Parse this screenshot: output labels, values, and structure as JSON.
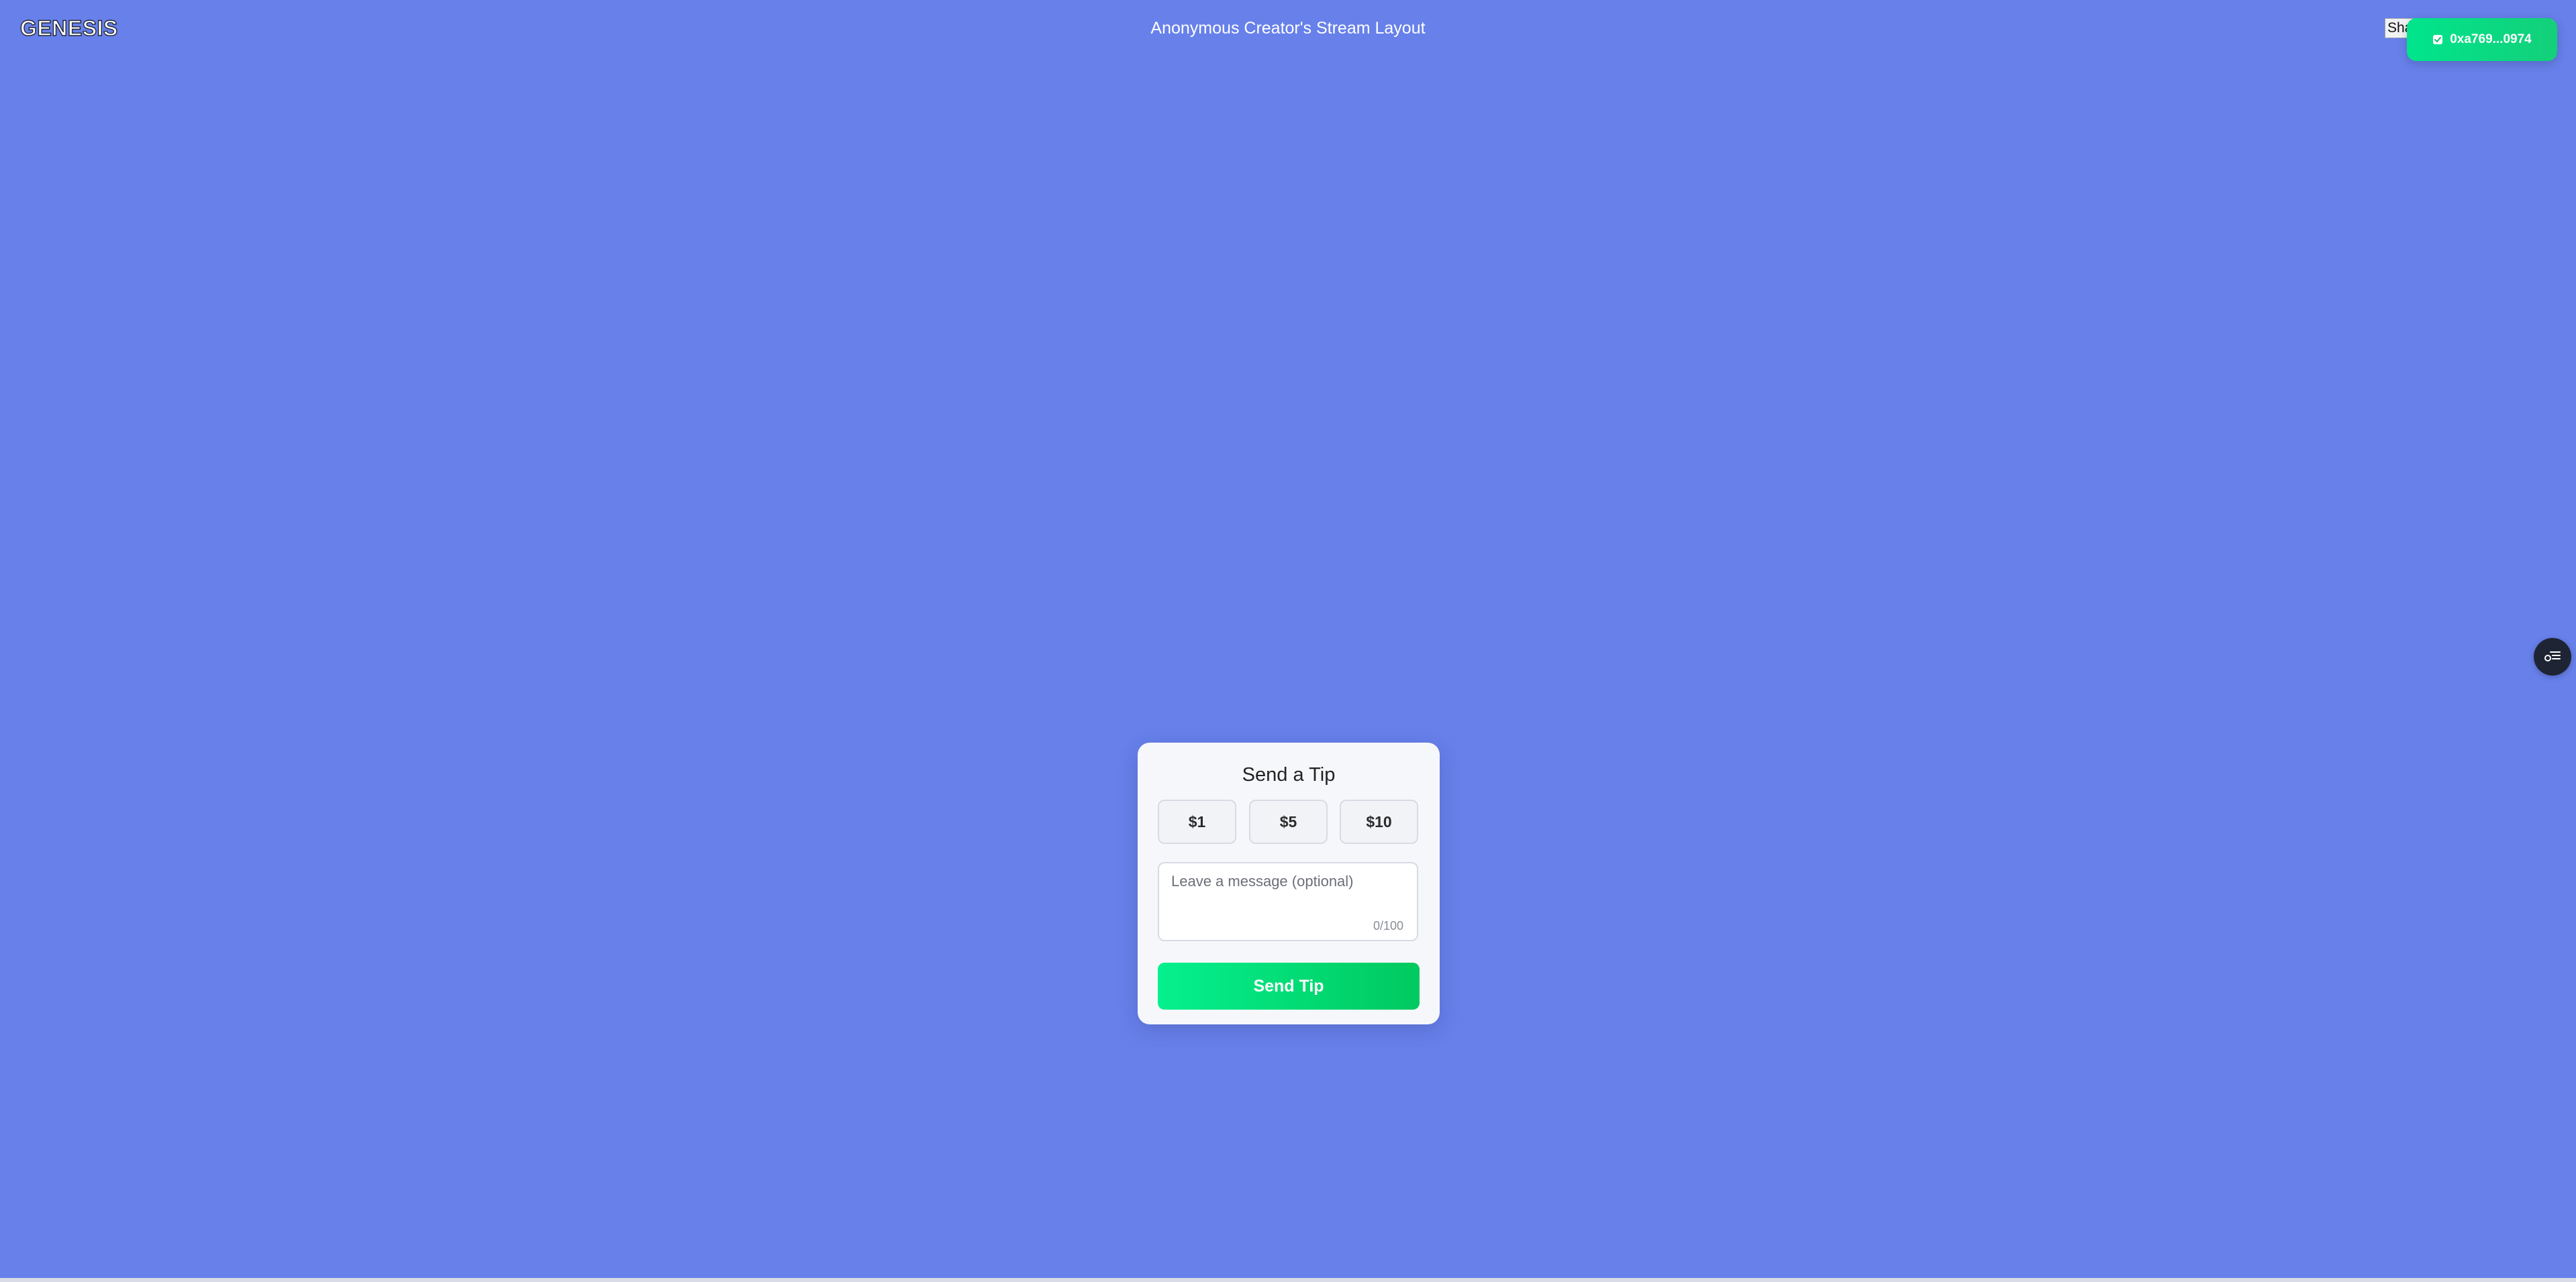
{
  "header": {
    "logo": "GENESIS",
    "title": "Anonymous Creator's Stream Layout",
    "share_label": "Sha"
  },
  "wallet": {
    "address": "0xa769...0974",
    "status_icon": "check-icon",
    "color": "#00e58c"
  },
  "fab": {
    "icon": "settings-list-icon"
  },
  "tip_widget": {
    "title": "Send a Tip",
    "amounts": [
      "$1",
      "$5",
      "$10"
    ],
    "message_placeholder": "Leave a message (optional)",
    "char_count": "0/100",
    "send_label": "Send Tip"
  },
  "colors": {
    "background": "#6780ea",
    "accent": "#05f08e",
    "fab": "#1e2433"
  }
}
